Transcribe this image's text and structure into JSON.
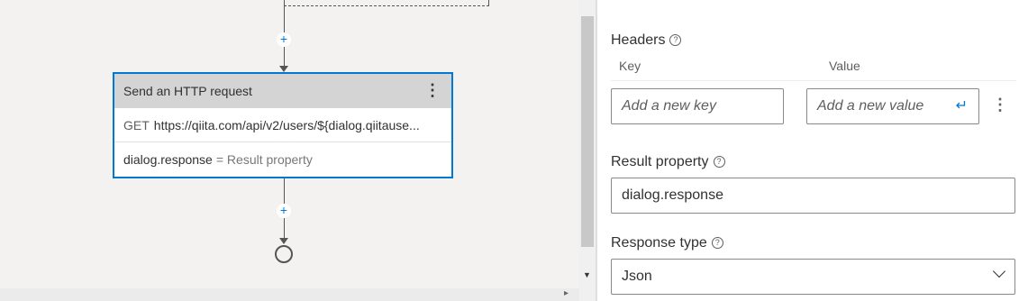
{
  "canvas": {
    "node": {
      "title": "Send an HTTP request",
      "menu_icon": "⋮",
      "method": "GET",
      "url": "https://qiita.com/api/v2/users/${dialog.qiitause...",
      "result_value": "dialog.response",
      "result_hint": "= Result property"
    },
    "add_icon": "+"
  },
  "panel": {
    "headers_label": "Headers",
    "help_icon": "?",
    "key_col": "Key",
    "value_col": "Value",
    "key_placeholder": "Add a new key",
    "value_placeholder": "Add a new value",
    "enter_icon": "↵",
    "more_icon": "⋮",
    "result_label": "Result property",
    "result_value": "dialog.response",
    "response_type_label": "Response type",
    "response_type_value": "Json"
  },
  "colors": {
    "accent": "#0078d4",
    "canvas_bg": "#f3f2f1",
    "node_header": "#d4d4d4"
  }
}
